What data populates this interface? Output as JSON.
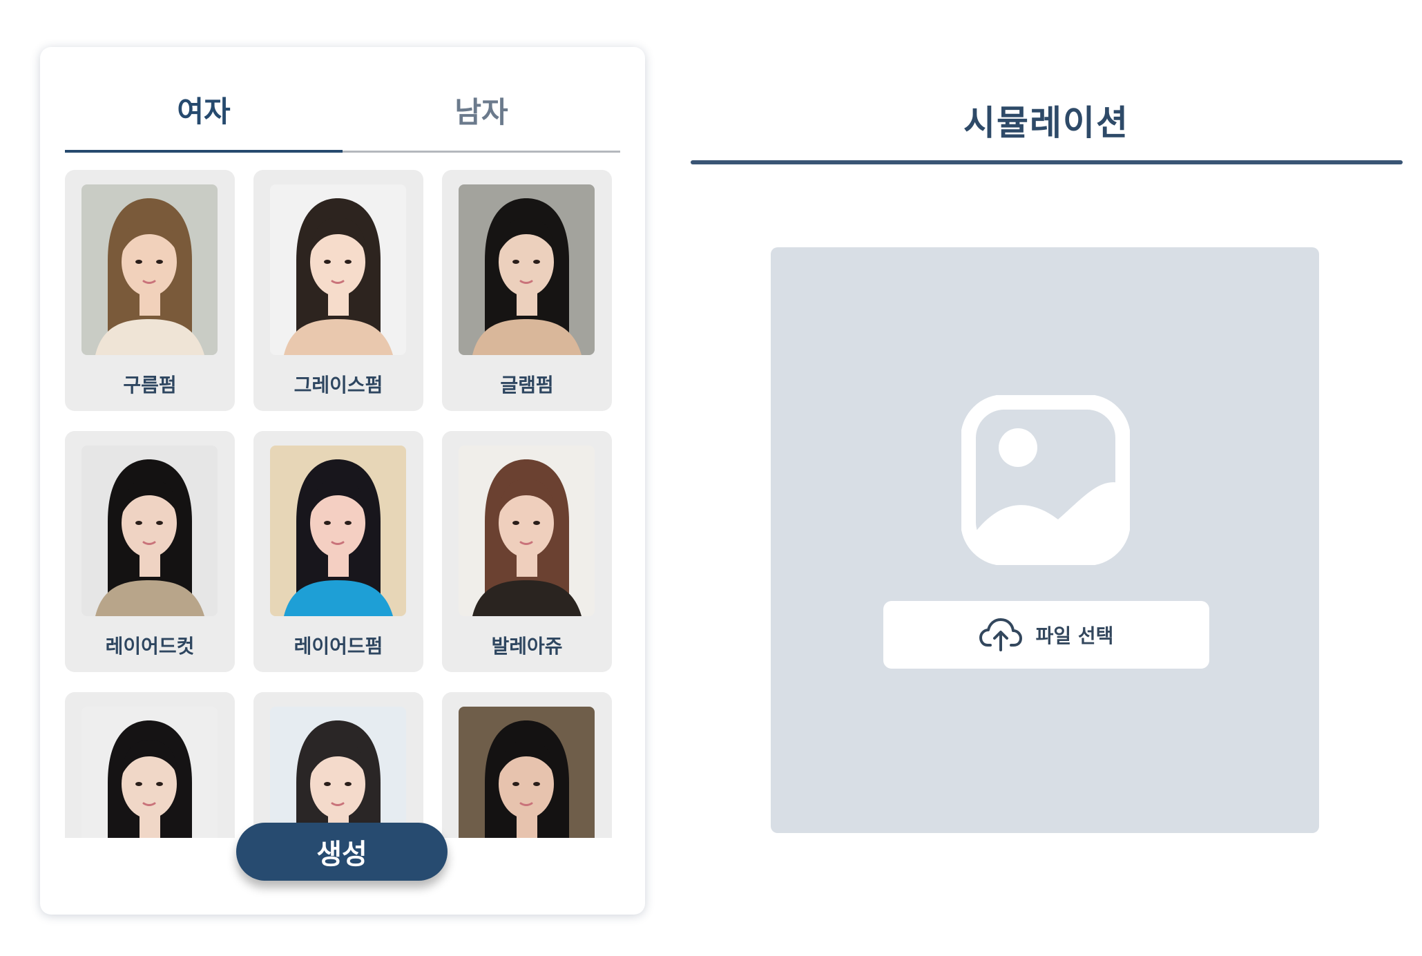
{
  "styles": {
    "tabs": {
      "women": "여자",
      "men": "남자"
    },
    "items": [
      {
        "label": "구름펌",
        "palette": {
          "bg": "#c9ccc5",
          "hair": "#7a5a3a",
          "skin": "#f1d1bb",
          "cloth": "#efe4d6"
        }
      },
      {
        "label": "그레이스펌",
        "palette": {
          "bg": "#f2f2f2",
          "hair": "#2d241f",
          "skin": "#f6dccb",
          "cloth": "#e9c8ae"
        }
      },
      {
        "label": "글램펌",
        "palette": {
          "bg": "#a3a39d",
          "hair": "#161413",
          "skin": "#ecd0bd",
          "cloth": "#d9b79a"
        }
      },
      {
        "label": "레이어드컷",
        "palette": {
          "bg": "#e6e6e6",
          "hair": "#141212",
          "skin": "#efd3c3",
          "cloth": "#b8a58a"
        }
      },
      {
        "label": "레이어드펌",
        "palette": {
          "bg": "#e7d6b7",
          "hair": "#18161c",
          "skin": "#f4cfc2",
          "cloth": "#1e9fd6"
        }
      },
      {
        "label": "발레아쥬",
        "palette": {
          "bg": "#f0eeea",
          "hair": "#6b4131",
          "skin": "#efcfbd",
          "cloth": "#2a2420"
        }
      },
      {
        "label": "",
        "palette": {
          "bg": "#eeeeee",
          "hair": "#151314",
          "skin": "#f0d7c7",
          "cloth": "#cccccc"
        }
      },
      {
        "label": "",
        "palette": {
          "bg": "#e6ecf1",
          "hair": "#2a2626",
          "skin": "#f4dacb",
          "cloth": "#cccccc"
        }
      },
      {
        "label": "",
        "palette": {
          "bg": "#6f5e4a",
          "hair": "#141212",
          "skin": "#e7c3ae",
          "cloth": "#333333"
        }
      }
    ],
    "generate_label": "생성"
  },
  "simulation": {
    "title": "시뮬레이션",
    "file_button_label": "파일 선택",
    "icons": {
      "placeholder": "image-placeholder-icon",
      "upload": "cloud-upload-icon"
    }
  },
  "colors": {
    "accent": "#274b70",
    "drop_area_bg": "#d8dee5",
    "card_bg": "#ececec"
  }
}
